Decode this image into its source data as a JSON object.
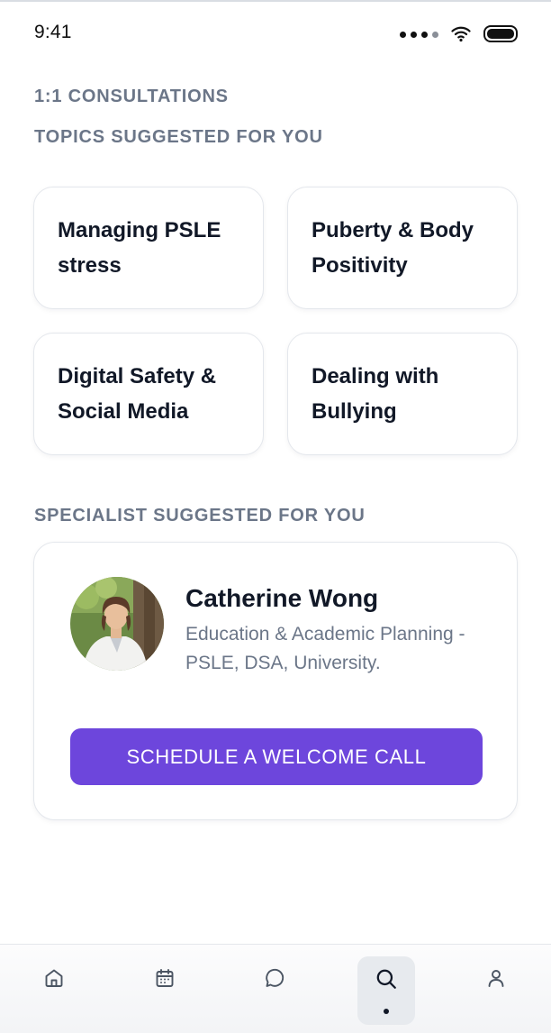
{
  "status_bar": {
    "time": "9:41"
  },
  "sections": {
    "consultations_label": "1:1 CONSULTATIONS",
    "topics_label": "TOPICS SUGGESTED FOR YOU",
    "specialist_label": "SPECIALIST SUGGESTED FOR YOU"
  },
  "topics": [
    {
      "title": "Managing PSLE stress"
    },
    {
      "title": "Puberty & Body Positivity"
    },
    {
      "title": "Digital Safety & Social Media"
    },
    {
      "title": "Dealing with Bullying"
    }
  ],
  "specialist": {
    "name": "Catherine Wong",
    "description": "Education & Academic Planning - PSLE, DSA, University.",
    "cta_label": "SCHEDULE A WELCOME CALL"
  },
  "tab_bar": {
    "items": [
      {
        "icon": "home-icon"
      },
      {
        "icon": "calendar-icon"
      },
      {
        "icon": "chat-icon"
      },
      {
        "icon": "search-icon",
        "active": true
      },
      {
        "icon": "profile-icon"
      }
    ]
  },
  "colors": {
    "accent": "#6d46dc",
    "muted_text": "#6b7688",
    "primary_text": "#111827",
    "card_border": "#e4e7ec"
  }
}
